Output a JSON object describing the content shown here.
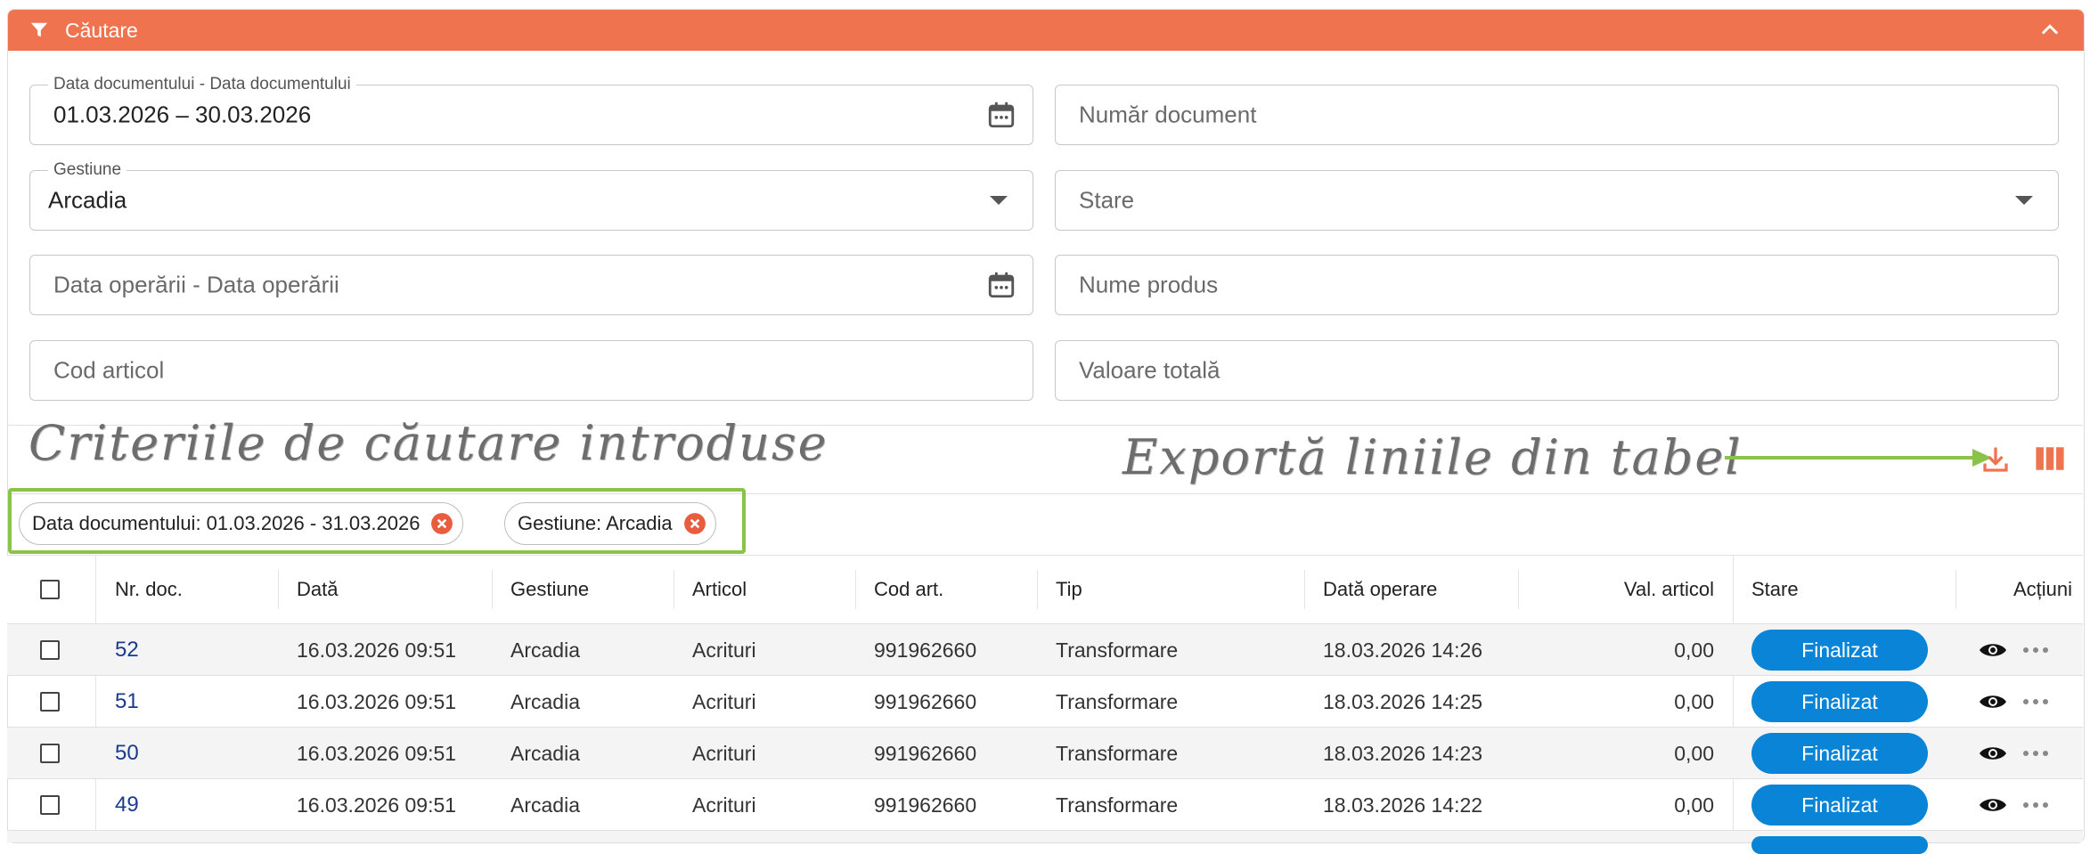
{
  "panel": {
    "title": "Căutare",
    "header_color": "#f07350"
  },
  "filters": {
    "doc_date": {
      "label": "Data documentului - Data documentului",
      "value": "01.03.2026 – 30.03.2026"
    },
    "doc_number": {
      "placeholder": "Număr document"
    },
    "gestiune": {
      "label": "Gestiune",
      "value": "Arcadia"
    },
    "stare": {
      "placeholder": "Stare"
    },
    "op_date": {
      "placeholder": "Data operării - Data operării"
    },
    "product_name": {
      "placeholder": "Nume produs"
    },
    "article_code": {
      "placeholder": "Cod articol"
    },
    "total_value": {
      "placeholder": "Valoare totală"
    }
  },
  "annotations": {
    "criteria": "Criteriile de căutare introduse",
    "export": "Exportă liniile din tabel",
    "highlight_color": "#8bc34a"
  },
  "chips": [
    {
      "label": "Data documentului: 01.03.2026 - 31.03.2026"
    },
    {
      "label": "Gestiune: Arcadia"
    }
  ],
  "table": {
    "headers": {
      "nr_doc": "Nr. doc.",
      "data": "Dată",
      "gestiune": "Gestiune",
      "articol": "Articol",
      "cod_art": "Cod art.",
      "tip": "Tip",
      "data_operare": "Dată operare",
      "val_articol": "Val. articol",
      "stare": "Stare",
      "actiuni": "Acțiuni"
    },
    "rows": [
      {
        "nr": "52",
        "data": "16.03.2026 09:51",
        "gestiune": "Arcadia",
        "articol": "Acrituri",
        "cod": "991962660",
        "tip": "Transformare",
        "operare": "18.03.2026 14:26",
        "val": "0,00",
        "stare": "Finalizat"
      },
      {
        "nr": "51",
        "data": "16.03.2026 09:51",
        "gestiune": "Arcadia",
        "articol": "Acrituri",
        "cod": "991962660",
        "tip": "Transformare",
        "operare": "18.03.2026 14:25",
        "val": "0,00",
        "stare": "Finalizat"
      },
      {
        "nr": "50",
        "data": "16.03.2026 09:51",
        "gestiune": "Arcadia",
        "articol": "Acrituri",
        "cod": "991962660",
        "tip": "Transformare",
        "operare": "18.03.2026 14:23",
        "val": "0,00",
        "stare": "Finalizat"
      },
      {
        "nr": "49",
        "data": "16.03.2026 09:51",
        "gestiune": "Arcadia",
        "articol": "Acrituri",
        "cod": "991962660",
        "tip": "Transformare",
        "operare": "18.03.2026 14:22",
        "val": "0,00",
        "stare": "Finalizat"
      }
    ],
    "status_color": "#0a84d6"
  },
  "icons": [
    "filter-icon",
    "chevron-up-icon",
    "calendar-icon",
    "dropdown-arrow-icon",
    "close-circle-icon",
    "download-icon",
    "columns-icon",
    "eye-icon",
    "more-icon"
  ]
}
